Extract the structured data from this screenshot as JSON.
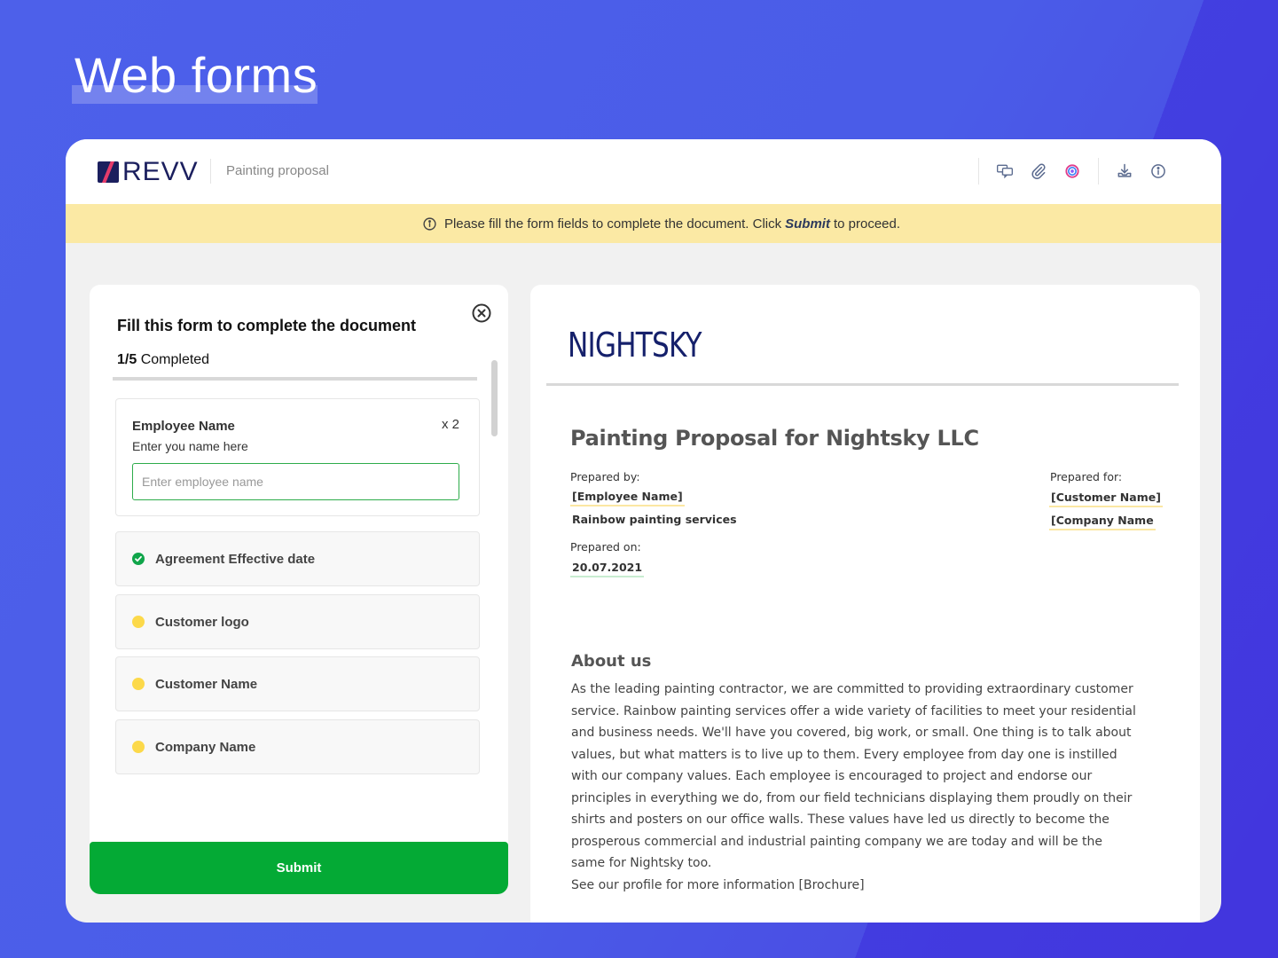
{
  "hero": {
    "title": "Web forms"
  },
  "app": {
    "logo_text": "REVV",
    "document_name": "Painting proposal",
    "toolbar": [
      {
        "name": "comments-icon"
      },
      {
        "name": "attachment-icon"
      },
      {
        "name": "integration-icon"
      },
      {
        "name": "download-icon"
      },
      {
        "name": "info-icon"
      }
    ]
  },
  "notice": {
    "prefix": "Please fill the form fields to complete the document. Click",
    "action": "Submit",
    "suffix": "to proceed."
  },
  "form": {
    "title": "Fill this form to complete the document",
    "progress_count": "1/5",
    "progress_label": "Completed",
    "progress_fraction": 0.2,
    "active_field": {
      "label": "Employee Name",
      "count": "x 2",
      "help": "Enter you name here",
      "placeholder": "Enter employee name",
      "value": ""
    },
    "fields": [
      {
        "label": "Agreement Effective date",
        "status": "done"
      },
      {
        "label": "Customer logo",
        "status": "pending"
      },
      {
        "label": "Customer Name",
        "status": "pending"
      },
      {
        "label": "Company Name",
        "status": "pending"
      }
    ],
    "submit_label": "Submit"
  },
  "document": {
    "brand": "NIGHTSKY",
    "heading": "Painting Proposal for  Nightsky LLC",
    "prepared_by_label": "Prepared by:",
    "prepared_by_value": "[Employee Name]",
    "prepared_by_company": "Rainbow painting services",
    "prepared_on_label": "Prepared on:",
    "prepared_on_value": "20.07.2021",
    "prepared_for_label": "Prepared for:",
    "prepared_for_customer": "[Customer Name]",
    "prepared_for_company": "[Company Name",
    "about_title": "About us",
    "about_body": "As the leading painting contractor, we are committed to providing extraordinary customer service. Rainbow painting services offer a wide variety of facilities to meet your residential and business needs. We'll have you covered, big work, or small. One thing is to talk about values, but what matters is to live up to them. Every employee from day one is instilled with our company values. Each employee is encouraged to project and endorse our principles in everything we do, from our field technicians displaying them proudly on their shirts and posters on our office walls. These values have led us directly to become the prosperous commercial and industrial painting company we are today and will be the same for Nightsky too.",
    "about_link": "See our profile for more information [Brochure]"
  }
}
